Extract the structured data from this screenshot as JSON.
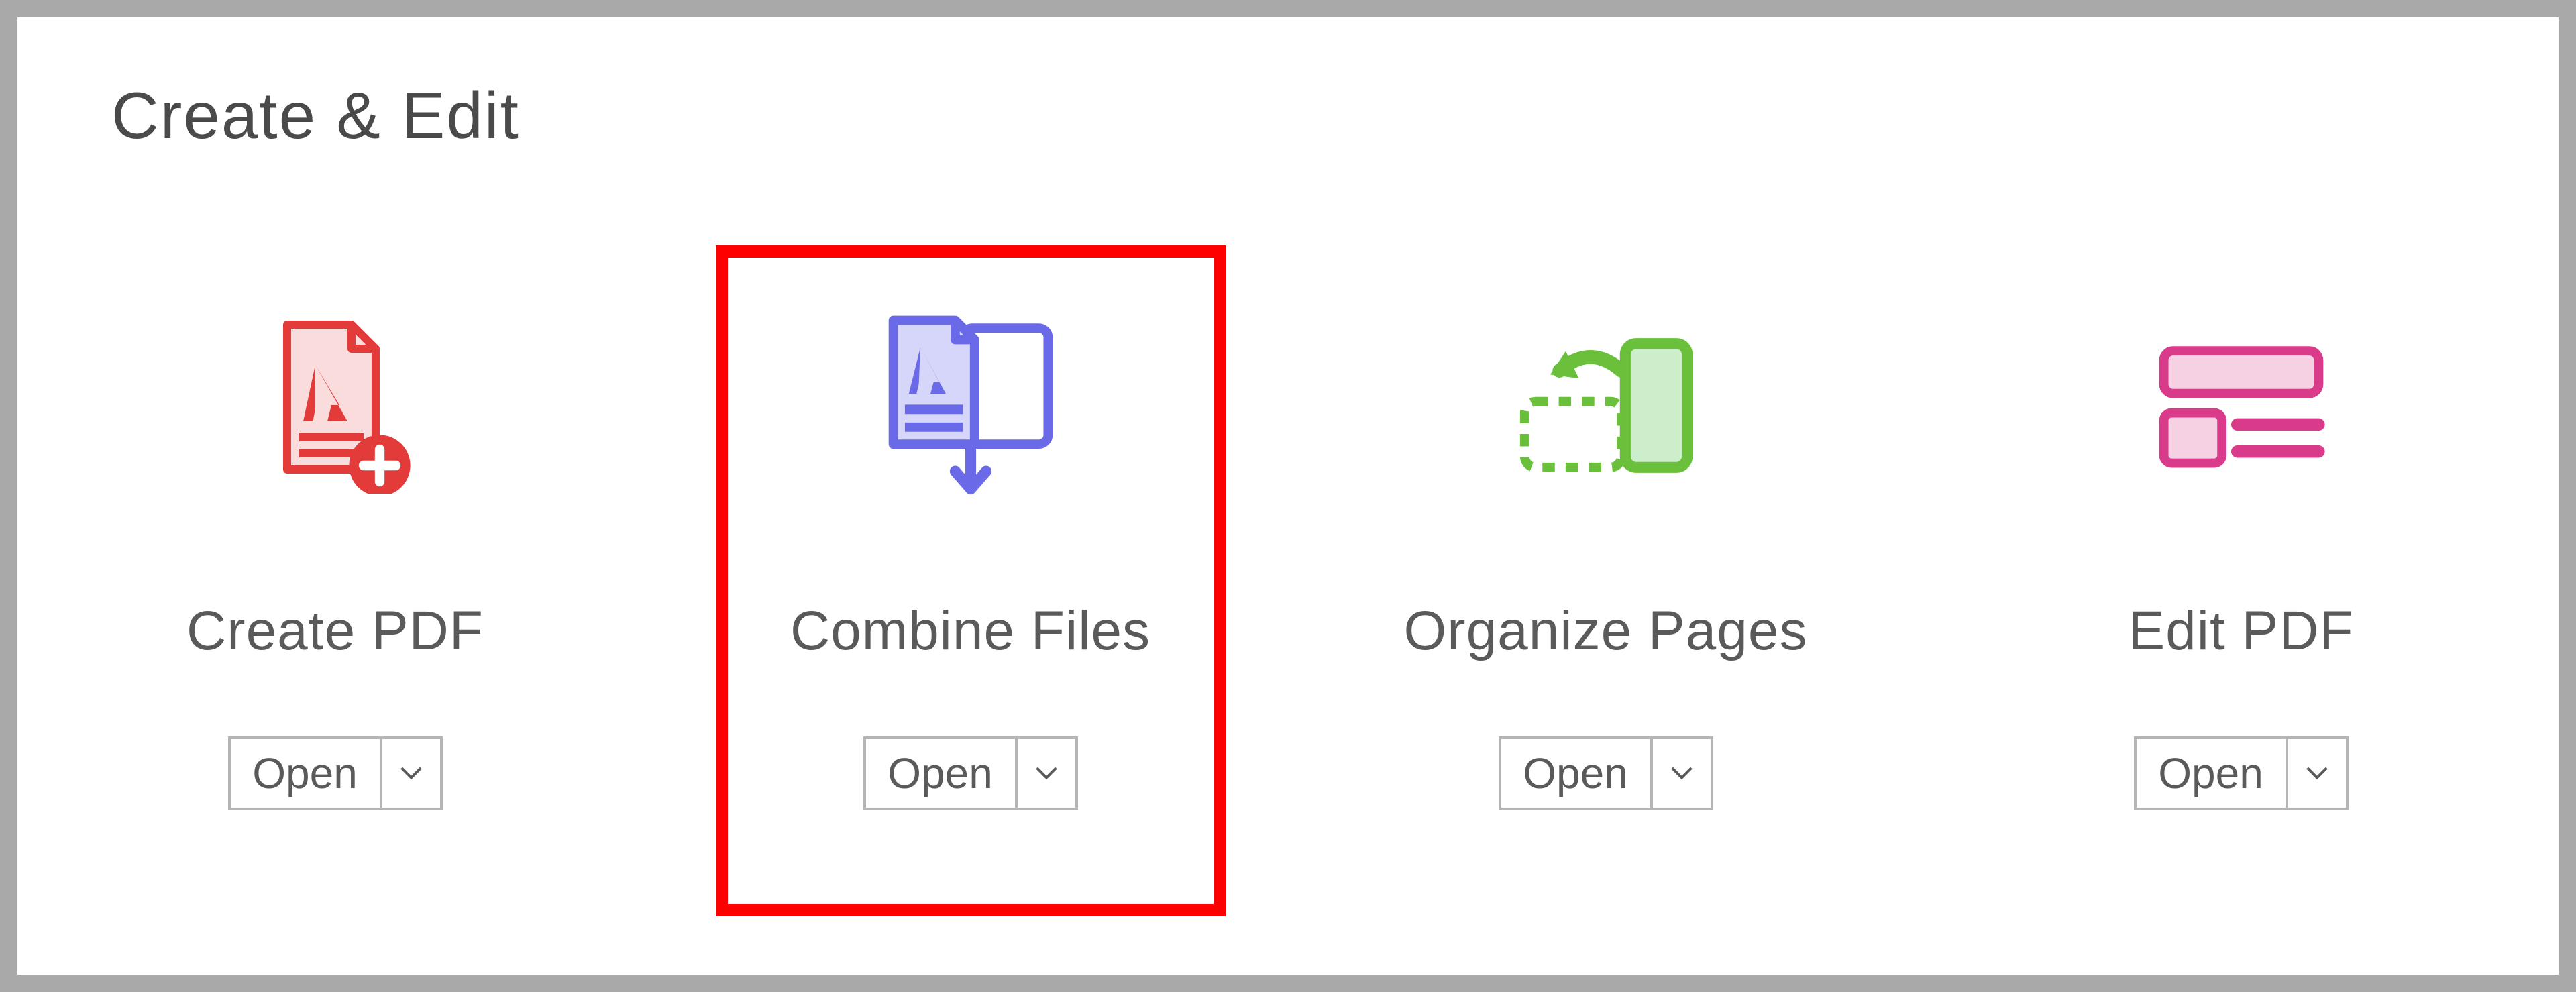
{
  "section": {
    "title": "Create & Edit"
  },
  "tools": [
    {
      "id": "create-pdf",
      "label": "Create PDF",
      "open_label": "Open",
      "highlighted": false,
      "icon": "create-pdf-icon",
      "icon_color": "#e33a3a"
    },
    {
      "id": "combine-files",
      "label": "Combine Files",
      "open_label": "Open",
      "highlighted": true,
      "icon": "combine-files-icon",
      "icon_color": "#6a6ae8"
    },
    {
      "id": "organize-pages",
      "label": "Organize Pages",
      "open_label": "Open",
      "highlighted": false,
      "icon": "organize-pages-icon",
      "icon_color": "#6ac03a"
    },
    {
      "id": "edit-pdf",
      "label": "Edit PDF",
      "open_label": "Open",
      "highlighted": false,
      "icon": "edit-pdf-icon",
      "icon_color": "#d93a8a"
    }
  ]
}
